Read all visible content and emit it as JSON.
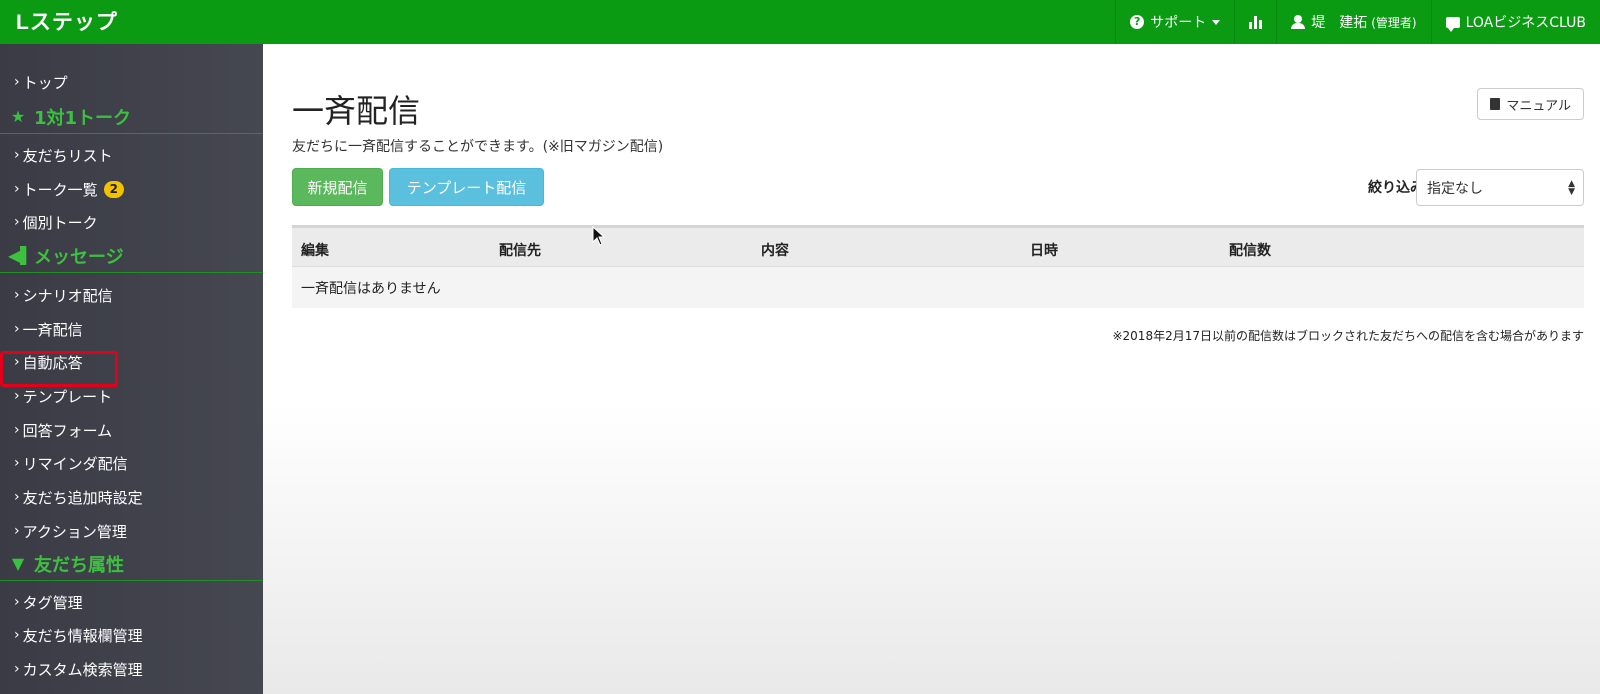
{
  "topbar": {
    "brand": "Lステップ",
    "support_label": "サポート",
    "user_name": "堤　建拓",
    "user_role": "(管理者)",
    "org_label": "LOAビジネスCLUB"
  },
  "sidebar": {
    "top": "トップ",
    "section_talk": "1対1トーク",
    "friend_list": "友だちリスト",
    "talk_list": "トーク一覧",
    "talk_badge": "2",
    "individual_talk": "個別トーク",
    "section_message": "メッセージ",
    "scenario": "シナリオ配信",
    "broadcast": "一斉配信",
    "auto_reply": "自動応答",
    "template": "テンプレート",
    "answer_form": "回答フォーム",
    "reminder": "リマインダ配信",
    "friend_add_settings": "友だち追加時設定",
    "action_manage": "アクション管理",
    "section_attr": "友だち属性",
    "tag_manage": "タグ管理",
    "friend_info_manage": "友だち情報欄管理",
    "custom_search": "カスタム検索管理"
  },
  "main": {
    "title": "一斉配信",
    "description": "友だちに一斉配信することができます。(※旧マガジン配信)",
    "manual_label": "マニュアル",
    "new_button": "新規配信",
    "template_button": "テンプレート配信",
    "filter_label": "絞り込み",
    "filter_value": "指定なし",
    "table": {
      "headers": [
        "編集",
        "配信先",
        "内容",
        "日時",
        "配信数"
      ],
      "empty_message": "一斉配信はありません"
    },
    "footnote": "※2018年2月17日以前の配信数はブロックされた友だちへの配信を含む場合があります"
  },
  "colors": {
    "topbar": "#0a9b13",
    "sidebar": "#3a3b45",
    "section_heading": "#3cc13f",
    "active_outline": "#e3001b",
    "btn_success": "#5cb85c",
    "btn_info": "#5bc0de",
    "badge": "#f2c200"
  }
}
